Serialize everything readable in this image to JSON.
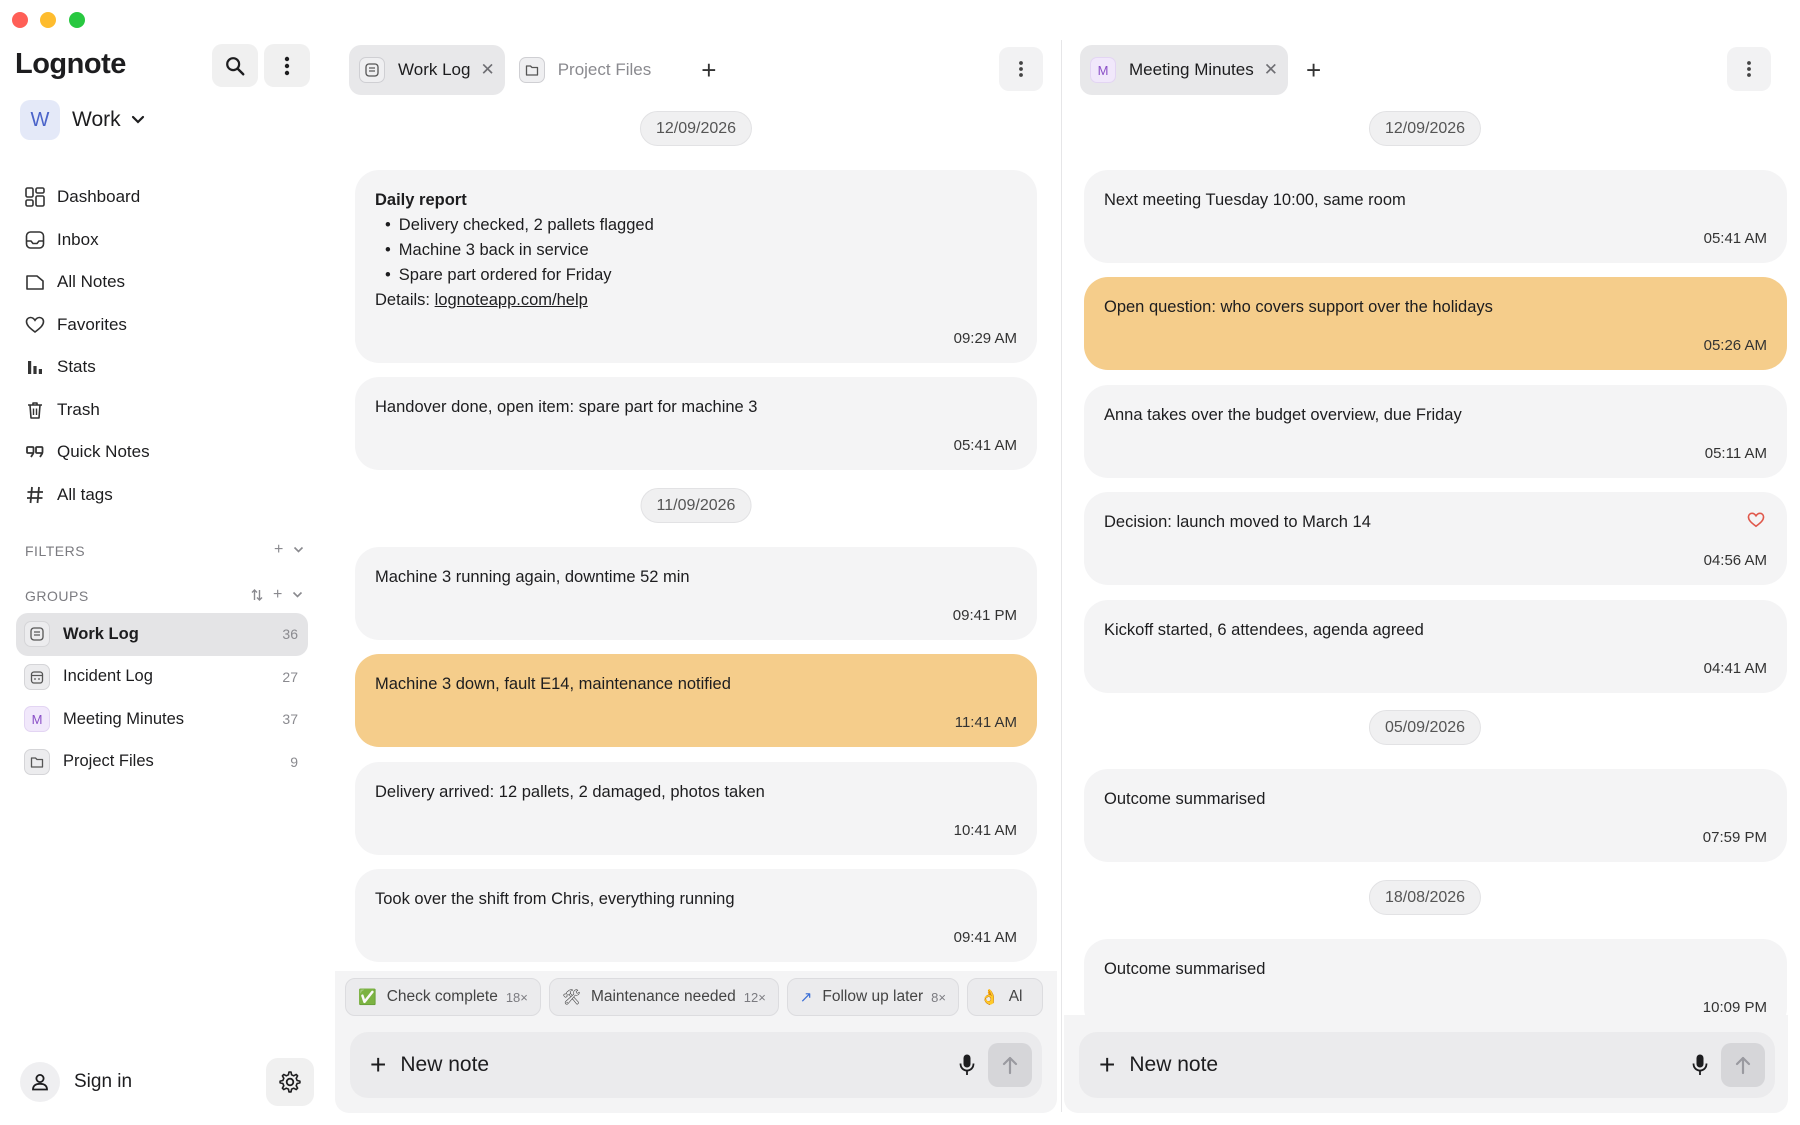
{
  "app": {
    "name": "Lognote"
  },
  "workspace": {
    "avatar": "W",
    "name": "Work"
  },
  "nav": [
    {
      "label": "Dashboard",
      "icon": "dashboard-icon"
    },
    {
      "label": "Inbox",
      "icon": "inbox-icon"
    },
    {
      "label": "All Notes",
      "icon": "notes-icon"
    },
    {
      "label": "Favorites",
      "icon": "heart-icon"
    },
    {
      "label": "Stats",
      "icon": "stats-icon"
    },
    {
      "label": "Trash",
      "icon": "trash-icon"
    },
    {
      "label": "Quick Notes",
      "icon": "quote-icon"
    },
    {
      "label": "All tags",
      "icon": "hash-icon"
    }
  ],
  "sections": {
    "filters": "FILTERS",
    "groups": "GROUPS"
  },
  "groups": [
    {
      "name": "Work Log",
      "count": "36",
      "icon": "log-icon",
      "active": true
    },
    {
      "name": "Incident Log",
      "count": "27",
      "icon": "calendar-icon",
      "active": false
    },
    {
      "name": "Meeting Minutes",
      "count": "37",
      "icon": "M",
      "active": false
    },
    {
      "name": "Project Files",
      "count": "9",
      "icon": "folder-icon",
      "active": false
    }
  ],
  "account": {
    "sign_in": "Sign in"
  },
  "left_pane": {
    "tabs": [
      {
        "label": "Work Log",
        "active": true
      },
      {
        "label": "Project Files",
        "active": false
      }
    ],
    "dates": [
      "12/09/2026",
      "11/09/2026"
    ],
    "notes": [
      {
        "title": "Daily report",
        "bullets": [
          "Delivery checked, 2 pallets flagged",
          "Machine 3 back in service",
          "Spare part ordered for Friday"
        ],
        "details_prefix": "Details: ",
        "link": "lognoteapp.com/help",
        "time": "09:29 AM"
      },
      {
        "text": "Handover done, open item: spare part for machine 3",
        "time": "05:41 AM"
      },
      {
        "text": "Machine 3 running again, downtime 52 min",
        "time": "09:41 PM"
      },
      {
        "text": "Machine 3 down, fault E14, maintenance notified",
        "time": "11:41 AM",
        "highlight": true
      },
      {
        "text": "Delivery arrived: 12 pallets, 2 damaged, photos taken",
        "time": "10:41 AM"
      },
      {
        "text": "Took over the shift from Chris, everything running",
        "time": "09:41 AM"
      }
    ],
    "quick_tags": [
      {
        "emoji": "✅",
        "label": "Check complete",
        "count": "18×"
      },
      {
        "emoji": "🛠",
        "label": "Maintenance needed",
        "count": "12×"
      },
      {
        "emoji": "↗",
        "label": "Follow up later",
        "count": "8×"
      },
      {
        "emoji": "👌",
        "label": "Al",
        "count": ""
      }
    ],
    "composer": {
      "placeholder": "New note"
    }
  },
  "right_pane": {
    "tabs": [
      {
        "label": "Meeting Minutes",
        "avatar": "M",
        "active": true
      }
    ],
    "dates": [
      "12/09/2026",
      "05/09/2026",
      "18/08/2026"
    ],
    "notes": [
      {
        "text": "Next meeting Tuesday 10:00, same room",
        "time": "05:41 AM"
      },
      {
        "text": "Open question: who covers support over the holidays",
        "time": "05:26 AM",
        "highlight": true
      },
      {
        "text": "Anna takes over the budget overview, due Friday",
        "time": "05:11 AM"
      },
      {
        "text": "Decision: launch moved to March 14",
        "time": "04:56 AM",
        "favorite": true
      },
      {
        "text": "Kickoff started, 6 attendees, agenda agreed",
        "time": "04:41 AM"
      },
      {
        "text": "Outcome summarised",
        "time": "07:59 PM"
      },
      {
        "text": "Outcome summarised",
        "time": "10:09 PM"
      }
    ],
    "composer": {
      "placeholder": "New note"
    }
  },
  "colors": {
    "highlight": "#f5cd8b",
    "card": "#f4f4f5",
    "heart": "#e0584b"
  }
}
